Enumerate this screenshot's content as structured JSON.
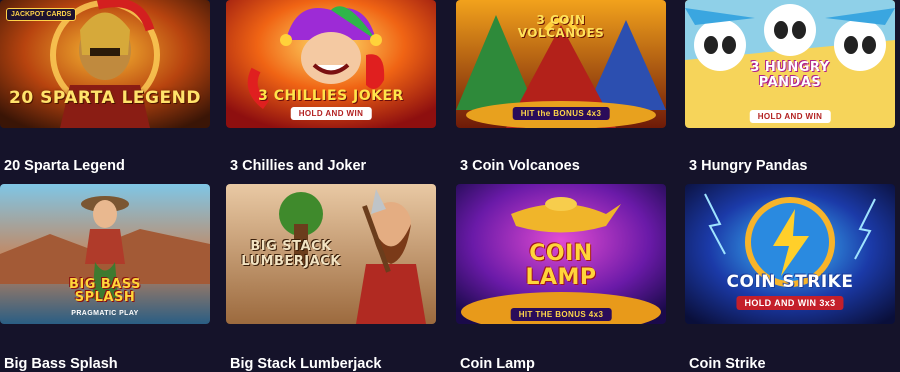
{
  "games": [
    {
      "title": "20 Sparta Legend",
      "logo": "20 SPARTA LEGEND",
      "badge": "JACKPOT CARDS",
      "sub": ""
    },
    {
      "title": "3 Chillies and Joker",
      "logo": "3 CHILLIES JOKER",
      "badge": "",
      "sub": "HOLD AND WIN"
    },
    {
      "title": "3 Coin Volcanoes",
      "logo": "3 COIN VOLCANOES",
      "badge": "",
      "sub": "HIT the BONUS 4x3"
    },
    {
      "title": "3 Hungry Pandas",
      "logo": "3 HUNGRY PANDAS",
      "badge": "",
      "sub": "HOLD AND WIN"
    },
    {
      "title": "Big Bass Splash",
      "logo": "BIG BASS SPLASH",
      "badge": "",
      "sub": "PRAGMATIC PLAY"
    },
    {
      "title": "Big Stack Lumberjack",
      "logo": "BIG STACK LUMBERJACK",
      "badge": "",
      "sub": ""
    },
    {
      "title": "Coin Lamp",
      "logo": "COIN LAMP",
      "badge": "",
      "sub": "HIT THE BONUS 4x3"
    },
    {
      "title": "Coin Strike",
      "logo": "COIN STRIKE",
      "badge": "",
      "sub": "HOLD AND WIN 3x3"
    }
  ],
  "colors": {
    "background": "#15132a",
    "title_text": "#ffffff"
  }
}
